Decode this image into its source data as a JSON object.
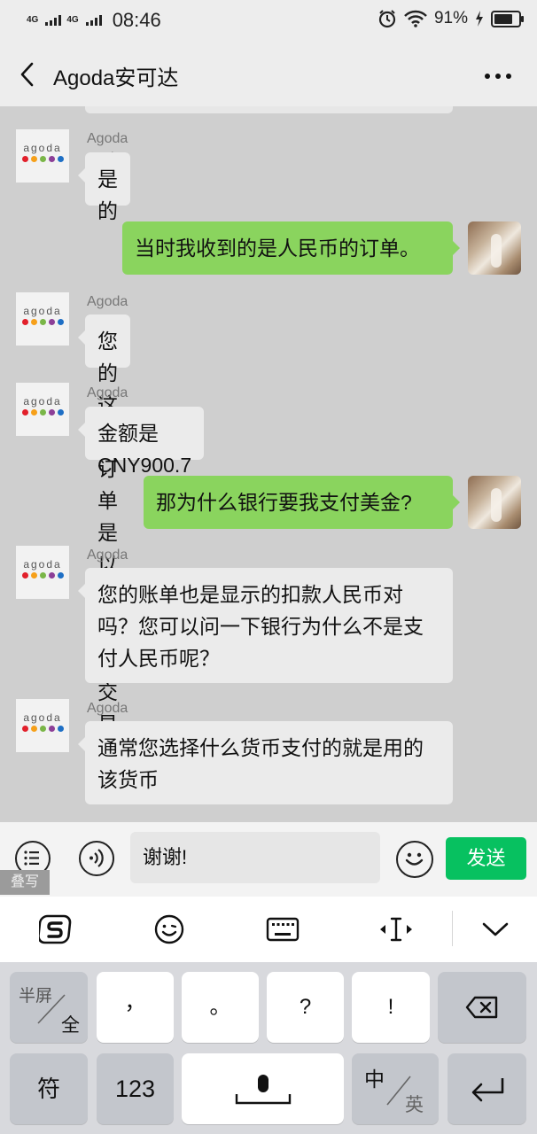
{
  "status_bar": {
    "network1": "4G",
    "network2": "4G",
    "time": "08:46",
    "battery": "91%",
    "battery_level": 0.91
  },
  "header": {
    "title": "Agoda安可达",
    "more_label": "···"
  },
  "messages": [
    {
      "side": "left",
      "sender": "Agoda - 珊妮",
      "text": "是的"
    },
    {
      "side": "right",
      "text": "当时我收到的是人民币的订单。"
    },
    {
      "side": "left",
      "sender": "Agoda - 珊妮",
      "text": "您的这笔订单是以人民币交易的"
    },
    {
      "side": "left",
      "sender": "Agoda - 珊妮",
      "text": "金额是 CNY900.7"
    },
    {
      "side": "right",
      "text": "那为什么银行要我支付美金?"
    },
    {
      "side": "left",
      "sender": "Agoda - 珊妮",
      "text": "您的账单也是显示的扣款人民币对吗？您可以问一下银行为什么不是支付人民币呢？"
    },
    {
      "side": "left",
      "sender": "Agoda - 珊妮",
      "text": "通常您选择什么货币支付的就是用的该货币"
    }
  ],
  "agoda_logo": {
    "text": "agoda",
    "dot_colors": [
      "#e2202b",
      "#f6a01a",
      "#7ab648",
      "#8c3f97",
      "#1e6fc5"
    ]
  },
  "input": {
    "value": "谢谢!",
    "send_label": "发送",
    "stack_tag": "叠写"
  },
  "keyboard": {
    "row1": {
      "half_top": "半屏",
      "half_bottom": "全",
      "comma": "，",
      "period": "。",
      "question": "?",
      "exclaim": "!"
    },
    "row2": {
      "symbols": "符",
      "numbers": "123",
      "lang_top": "中",
      "lang_bottom": "英"
    }
  }
}
